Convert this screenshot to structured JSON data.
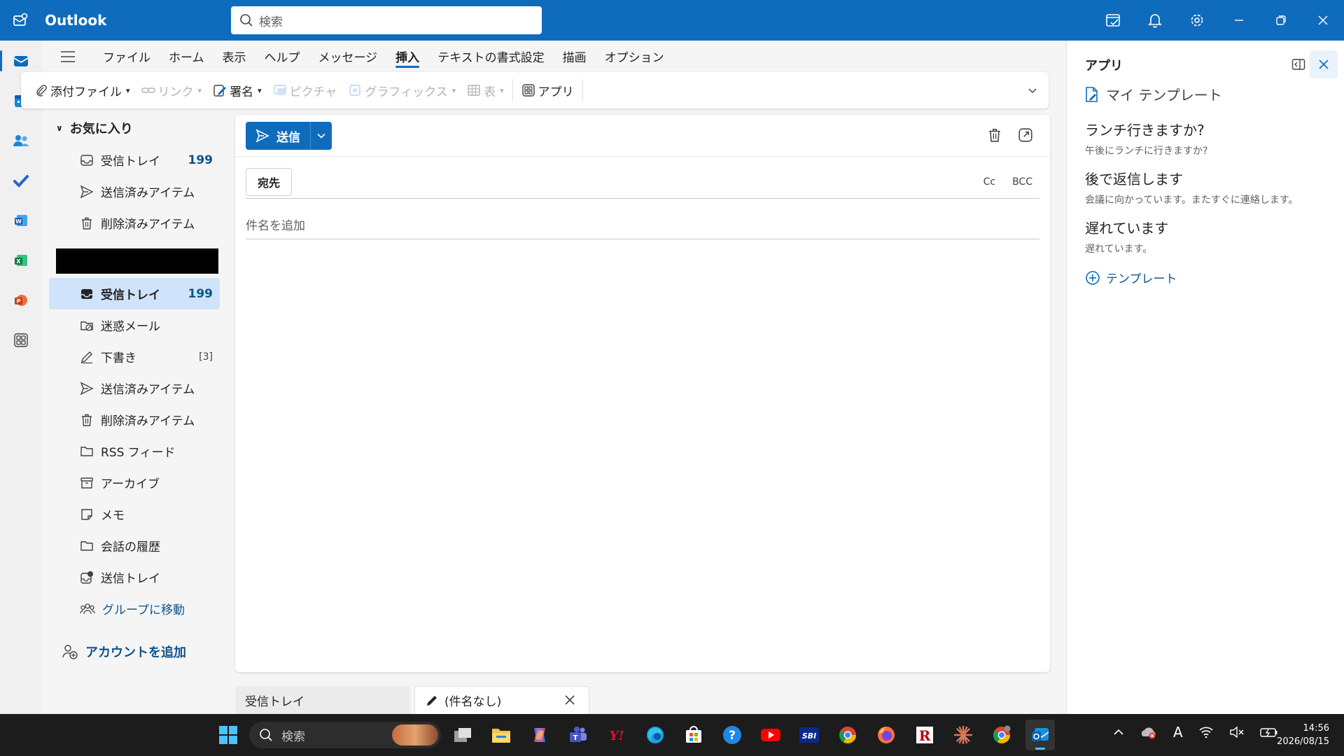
{
  "titlebar": {
    "app_name": "Outlook",
    "search_placeholder": "検索"
  },
  "ribbon": {
    "tabs": [
      "ファイル",
      "ホーム",
      "表示",
      "ヘルプ",
      "メッセージ",
      "挿入",
      "テキストの書式設定",
      "描画",
      "オプション"
    ],
    "active_tab": "挿入",
    "tools": {
      "attach": "添付ファイル",
      "link": "リンク",
      "signature": "署名",
      "picture": "ピクチャ",
      "graphics": "グラフィックス",
      "table": "表",
      "apps": "アプリ"
    }
  },
  "folders": {
    "favorites_label": "お気に入り",
    "favorites": [
      {
        "label": "受信トレイ",
        "count": "199"
      },
      {
        "label": "送信済みアイテム"
      },
      {
        "label": "削除済みアイテム"
      }
    ],
    "account": [
      {
        "label": "受信トレイ",
        "count": "199"
      },
      {
        "label": "迷惑メール"
      },
      {
        "label": "下書き",
        "count": "[3]"
      },
      {
        "label": "送信済みアイテム"
      },
      {
        "label": "削除済みアイテム"
      },
      {
        "label": "RSS フィード"
      },
      {
        "label": "アーカイブ"
      },
      {
        "label": "メモ"
      },
      {
        "label": "会話の履歴"
      },
      {
        "label": "送信トレイ"
      },
      {
        "label": "グループに移動"
      }
    ],
    "add_account": "アカウントを追加"
  },
  "compose": {
    "send_label": "送信",
    "to_label": "宛先",
    "cc_label": "Cc",
    "bcc_label": "BCC",
    "subject_placeholder": "件名を追加"
  },
  "bottom_tabs": [
    {
      "label": "受信トレイ"
    },
    {
      "label": "(件名なし)"
    }
  ],
  "apps_pane": {
    "title": "アプリ",
    "subtitle": "マイ テンプレート",
    "templates": [
      {
        "title": "ランチ行きますか?",
        "body": "午後にランチに行きますか?"
      },
      {
        "title": "後で返信します",
        "body": "会議に向かっています。またすぐに連絡します。"
      },
      {
        "title": "遅れています",
        "body": "遅れています。"
      }
    ],
    "add_template": "テンプレート"
  },
  "taskbar": {
    "search_placeholder": "検索",
    "time": "14:56",
    "date": "2026/08/15",
    "ime_indicator": "A"
  },
  "colors": {
    "accent": "#0f6cbd",
    "selected": "#cfe4fa",
    "link": "#0f548c"
  }
}
